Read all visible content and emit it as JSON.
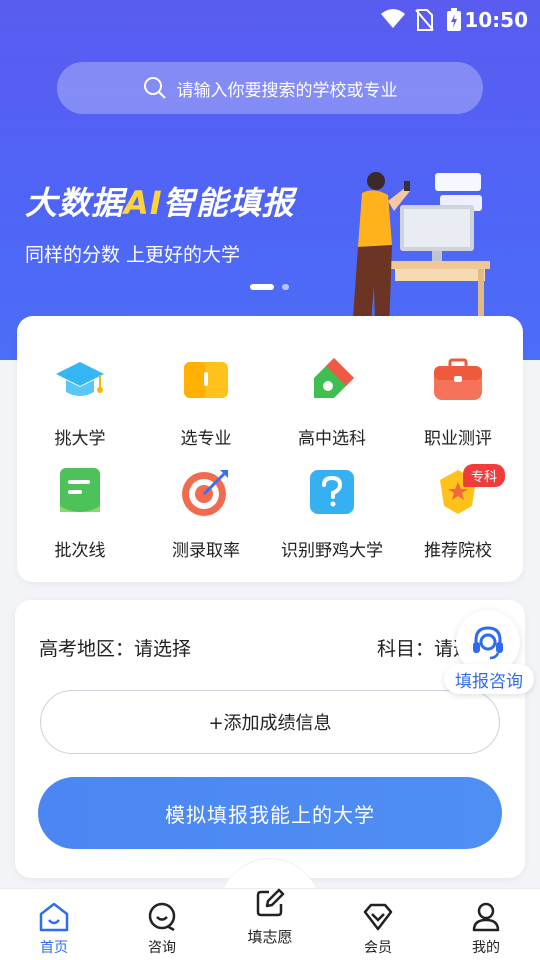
{
  "status": {
    "time": "10:50"
  },
  "search": {
    "placeholder": "请输入你要搜索的学校或专业"
  },
  "banner": {
    "title_pre": "大数据",
    "title_ai": "AI",
    "title_post": "智能填报",
    "subtitle": "同样的分数 上更好的大学"
  },
  "grid": {
    "items": [
      {
        "label": "挑大学",
        "icon": "graduation-cap-icon"
      },
      {
        "label": "选专业",
        "icon": "book-icon"
      },
      {
        "label": "高中选科",
        "icon": "pencil-icon"
      },
      {
        "label": "职业测评",
        "icon": "briefcase-icon"
      },
      {
        "label": "批次线",
        "icon": "scroll-icon"
      },
      {
        "label": "测录取率",
        "icon": "target-icon"
      },
      {
        "label": "识别野鸡大学",
        "icon": "question-icon"
      },
      {
        "label": "推荐院校",
        "icon": "star-badge-icon"
      }
    ],
    "badge": "专科"
  },
  "form": {
    "region": "高考地区：请选择",
    "subject": "科目：请选",
    "add_label": "+添加成绩信息",
    "submit_label": "模拟填报我能上的大学"
  },
  "consult": {
    "label": "填报咨询"
  },
  "tabs": {
    "home": "首页",
    "consult": "咨询",
    "fill": "填志愿",
    "member": "会员",
    "mine": "我的"
  },
  "colors": {
    "accent": "#2e6df2",
    "hero": "#5a5cf0",
    "badge": "#f23c3c"
  }
}
